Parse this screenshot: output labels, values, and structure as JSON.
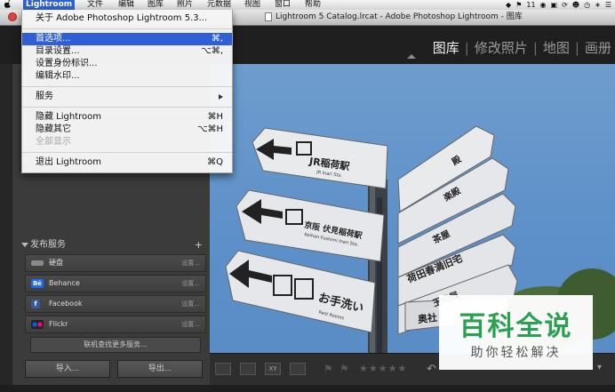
{
  "menubar": {
    "apple": "",
    "items": [
      "Lightroom",
      "文件",
      "编辑",
      "图库",
      "照片",
      "元数据",
      "视图",
      "窗口",
      "帮助"
    ],
    "active_index": 0,
    "tray": {
      "badge": "11"
    }
  },
  "window": {
    "title": "Lightroom 5 Catalog.lrcat - Adobe Photoshop Lightroom - 图库"
  },
  "modules": {
    "items": [
      "图库",
      "修改照片",
      "地图",
      "画册"
    ],
    "active_index": 0
  },
  "app_menu": {
    "about": "关于 Adobe Photoshop Lightroom 5.3...",
    "preferences": "首选项...",
    "preferences_sc": "⌘,",
    "catalog_settings": "目录设置...",
    "catalog_settings_sc": "⌥⌘,",
    "identity_plate": "设置身份标识...",
    "watermarks": "编辑水印...",
    "services": "服务",
    "hide_lightroom": "隐藏 Lightroom",
    "hide_lightroom_sc": "⌘H",
    "hide_others": "隐藏其它",
    "hide_others_sc": "⌥⌘H",
    "show_all": "全部显示",
    "quit": "退出 Lightroom",
    "quit_sc": "⌘Q"
  },
  "publish": {
    "title": "发布服务",
    "plus": "+",
    "services": [
      {
        "name": "硬盘",
        "setup": "设置..."
      },
      {
        "name": "Behance",
        "setup": "设置..."
      },
      {
        "name": "Facebook",
        "setup": "设置..."
      },
      {
        "name": "Flickr",
        "setup": "设置..."
      }
    ],
    "more": "联机查找更多服务..."
  },
  "buttons": {
    "import": "导入...",
    "export": "导出..."
  },
  "photo": {
    "signs": {
      "jr_inari": "JR稲荷駅",
      "jr_inari_sub": "JR Inari Sta.",
      "keihan": "京阪 伏見稲荷駅",
      "keihan_sub": "Keihan Fushimi Inari Sta.",
      "restroom": "お手洗い",
      "restroom_sub": "Rest Rooms",
      "right_1": "殿",
      "right_2": "楽殿",
      "right_3": "茶屋",
      "right_4": "荷田春満旧宅",
      "right_5": "玉鳥居",
      "right_6": "奥社"
    }
  },
  "toolbar": {
    "stars": "★★★★★"
  },
  "watermark": {
    "main": "百科全说",
    "sub": "助你轻松解决"
  },
  "colors": {
    "accent": "#2f5fd6",
    "sky": "#5d90c9",
    "watermark_green": "#2b9f52"
  }
}
